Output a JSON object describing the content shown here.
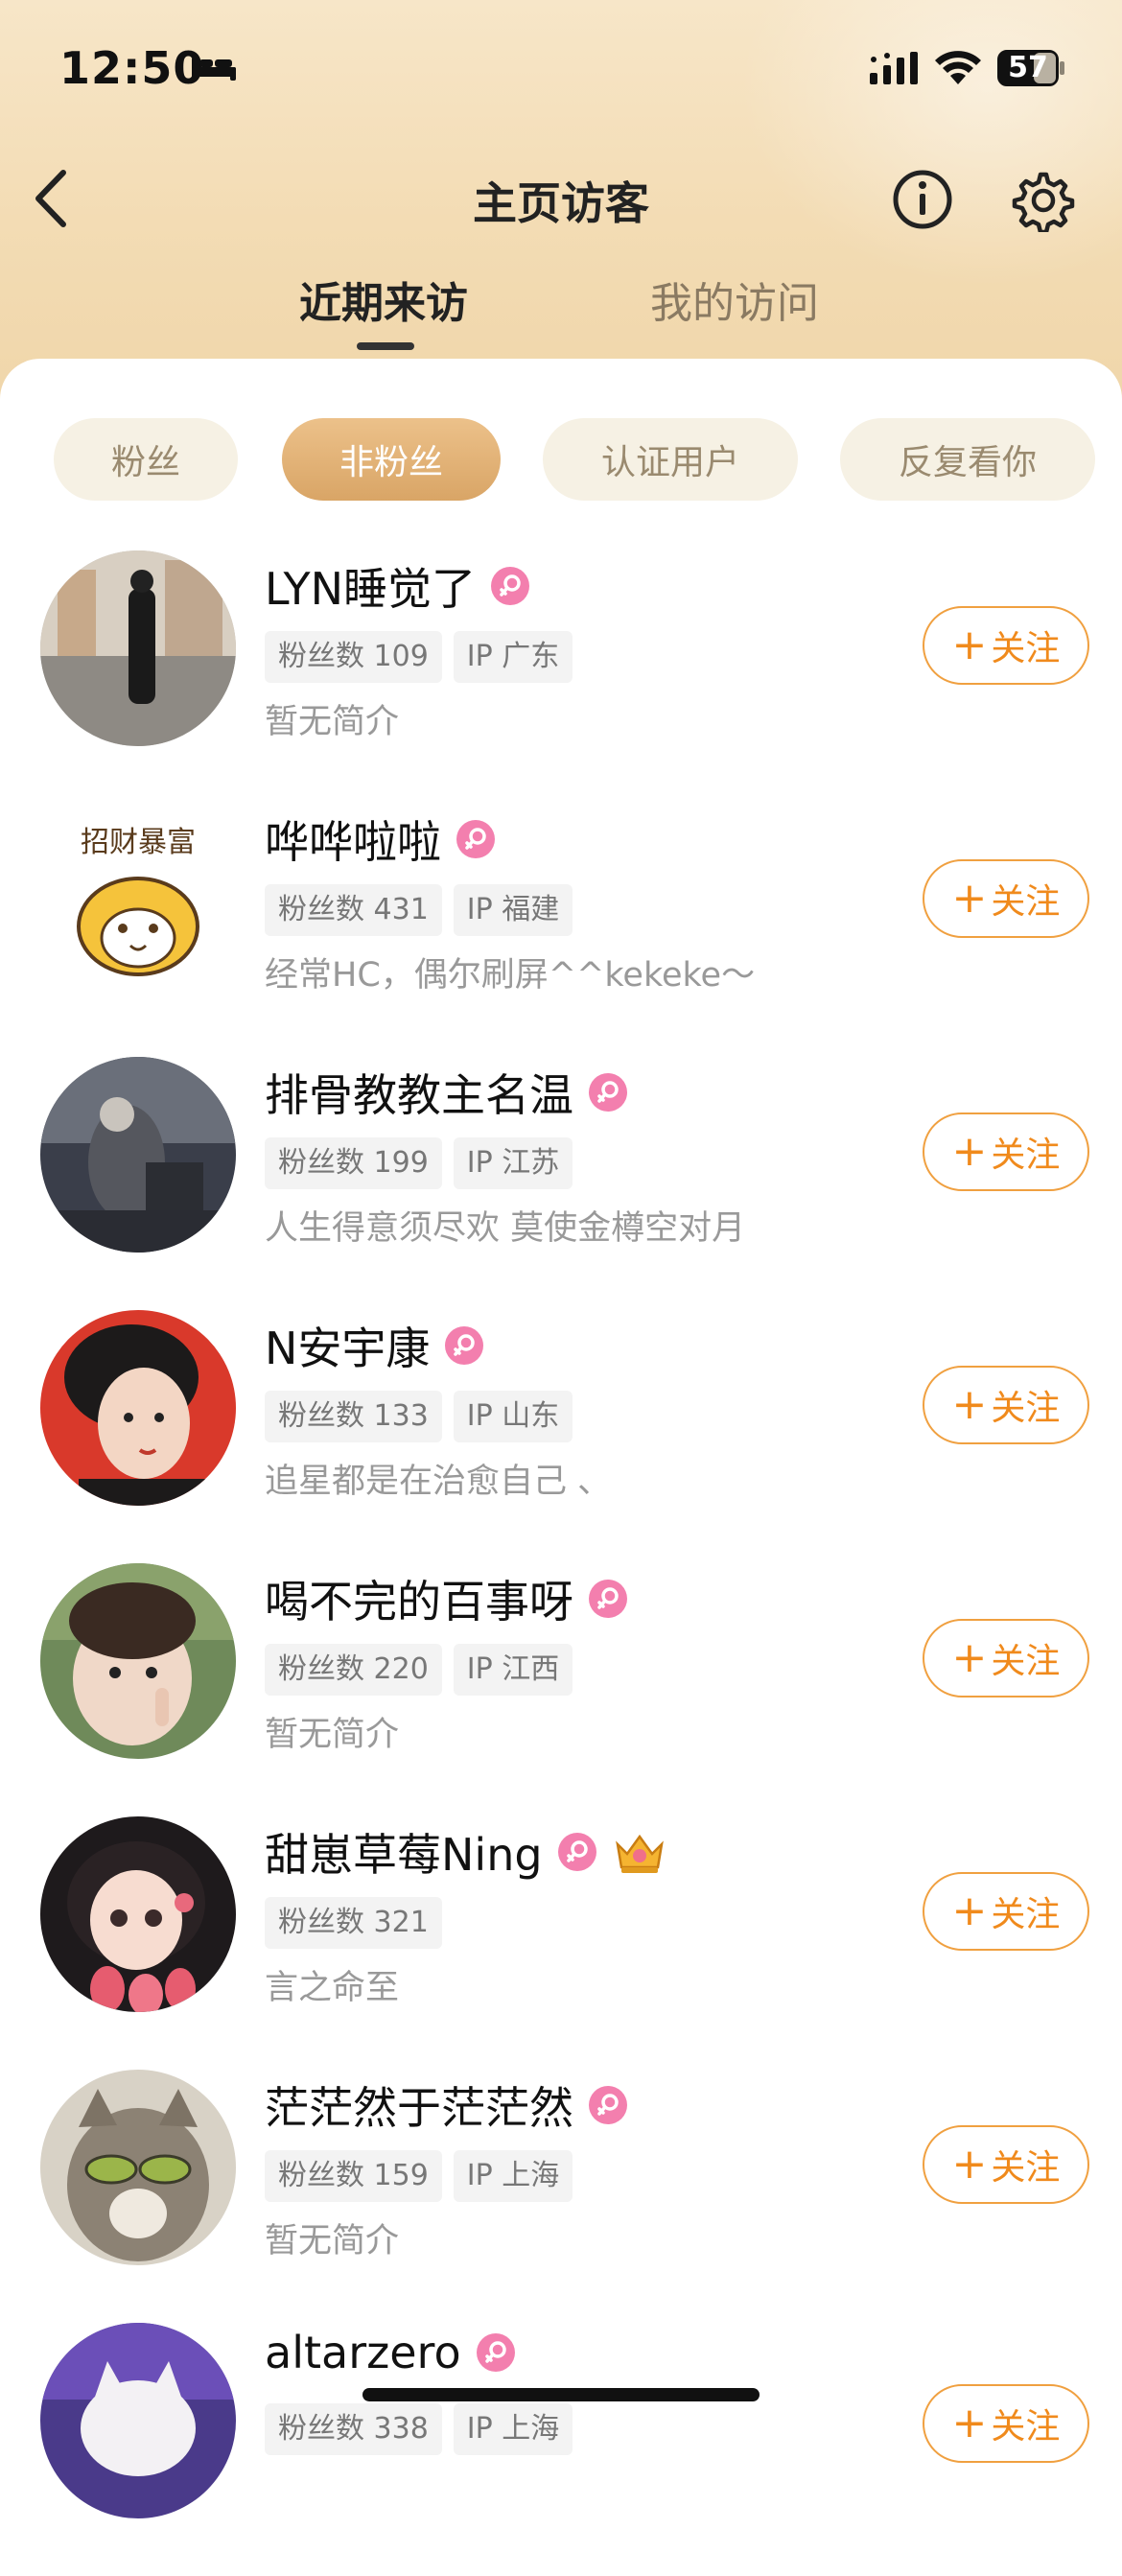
{
  "status_bar": {
    "time": "12:50",
    "battery": "57"
  },
  "header": {
    "title": "主页访客"
  },
  "tabs": [
    {
      "label": "近期来访"
    },
    {
      "label": "我的访问"
    }
  ],
  "filters": [
    {
      "label": "粉丝"
    },
    {
      "label": "非粉丝"
    },
    {
      "label": "认证用户"
    },
    {
      "label": "反复看你"
    }
  ],
  "follow_label": "关注",
  "visitors": [
    {
      "name": "LYN睡觉了",
      "fans": "粉丝数 109",
      "ip": "IP 广东",
      "bio": "暂无简介"
    },
    {
      "name": "哗哗啦啦",
      "fans": "粉丝数 431",
      "ip": "IP 福建",
      "bio": "经常HC，偶尔刷屏^^kekeke～"
    },
    {
      "name": "排骨教教主名温",
      "fans": "粉丝数 199",
      "ip": "IP 江苏",
      "bio": "人生得意须尽欢 莫使金樽空对月"
    },
    {
      "name": "N安宇康",
      "fans": "粉丝数 133",
      "ip": "IP 山东",
      "bio": "追星都是在治愈自己 、"
    },
    {
      "name": "喝不完的百事呀",
      "fans": "粉丝数 220",
      "ip": "IP 江西",
      "bio": "暂无简介"
    },
    {
      "name": "甜崽草莓Ning",
      "fans": "粉丝数 321",
      "ip": "",
      "bio": "言之命至"
    },
    {
      "name": "茫茫然于茫茫然",
      "fans": "粉丝数 159",
      "ip": "IP 上海",
      "bio": "暂无简介"
    },
    {
      "name": "altarzero",
      "fans": "粉丝数 338",
      "ip": "IP 上海",
      "bio": ""
    }
  ],
  "avatar_text": "招财暴富"
}
